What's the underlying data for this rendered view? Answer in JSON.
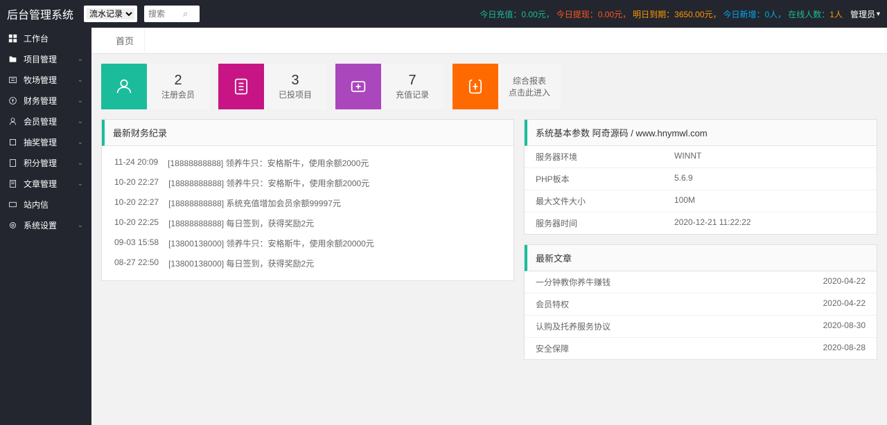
{
  "header": {
    "logo": "后台管理系统",
    "select_option": "流水记录",
    "search_placeholder": "搜索",
    "stats": {
      "recharge_label": "今日充值：",
      "recharge_value": "0.00元，",
      "withdraw_label": "今日提现：",
      "withdraw_value": "0.00元，",
      "expire_label": "明日到期：",
      "expire_value": "3650.00元，",
      "new_label": "今日新增：",
      "new_value": "0人，",
      "online_label": "在线人数：",
      "online_value": "1人"
    },
    "admin": "管理员"
  },
  "sidebar": {
    "items": [
      {
        "label": "工作台",
        "expandable": false
      },
      {
        "label": "项目管理",
        "expandable": true
      },
      {
        "label": "牧场管理",
        "expandable": true
      },
      {
        "label": "财务管理",
        "expandable": true
      },
      {
        "label": "会员管理",
        "expandable": true
      },
      {
        "label": "抽奖管理",
        "expandable": true
      },
      {
        "label": "积分管理",
        "expandable": true
      },
      {
        "label": "文章管理",
        "expandable": true
      },
      {
        "label": "站内信",
        "expandable": false
      },
      {
        "label": "系统设置",
        "expandable": true
      }
    ]
  },
  "tabs": {
    "home": "首页"
  },
  "cards": {
    "members": {
      "num": "2",
      "label": "注册会员"
    },
    "projects": {
      "num": "3",
      "label": "已投项目"
    },
    "recharge": {
      "num": "7",
      "label": "充值记录"
    },
    "report": {
      "line1": "综合报表",
      "line2": "点击此进入"
    }
  },
  "finance": {
    "title": "最新财务纪录",
    "records": [
      {
        "time": "11-24 20:09",
        "phone": "[18888888888]",
        "desc": "领养牛只：安格斯牛，使用余额2000元"
      },
      {
        "time": "10-20 22:27",
        "phone": "[18888888888]",
        "desc": "领养牛只：安格斯牛，使用余额2000元"
      },
      {
        "time": "10-20 22:27",
        "phone": "[18888888888]",
        "desc": "系统充值增加会员余额99997元"
      },
      {
        "time": "10-20 22:25",
        "phone": "[18888888888]",
        "desc": "每日签到，获得奖励2元"
      },
      {
        "time": "09-03 15:58",
        "phone": "[13800138000]",
        "desc": "领养牛只：安格斯牛，使用余额20000元"
      },
      {
        "time": "08-27 22:50",
        "phone": "[13800138000]",
        "desc": "每日签到，获得奖励2元"
      }
    ]
  },
  "sysinfo": {
    "title": "系统基本参数 阿奇源码 / www.hnymwl.com",
    "rows": [
      {
        "label": "服务器环境",
        "value": "WINNT"
      },
      {
        "label": "PHP板本",
        "value": "5.6.9"
      },
      {
        "label": "最大文件大小",
        "value": "100M"
      },
      {
        "label": "服务器时间",
        "value": "2020-12-21 11:22:22"
      }
    ]
  },
  "articles": {
    "title": "最新文章",
    "rows": [
      {
        "title": "一分钟教你养牛赚钱",
        "date": "2020-04-22"
      },
      {
        "title": "会员特权",
        "date": "2020-04-22"
      },
      {
        "title": "认购及托养服务协议",
        "date": "2020-08-30"
      },
      {
        "title": "安全保障",
        "date": "2020-08-28"
      }
    ]
  }
}
